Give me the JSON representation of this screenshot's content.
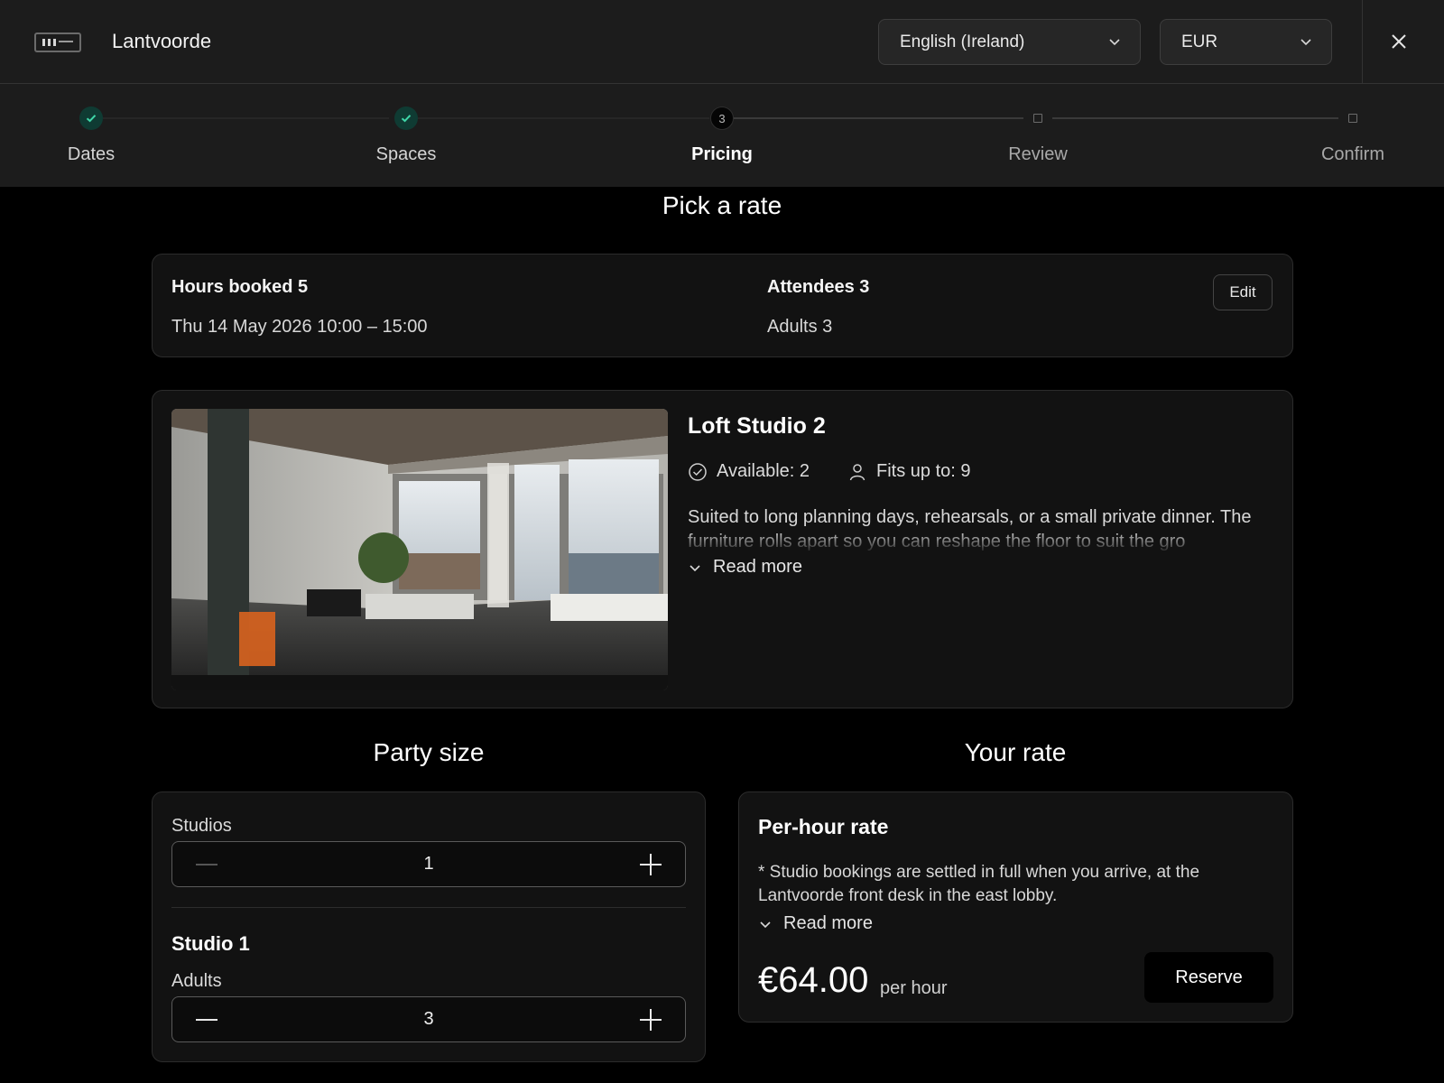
{
  "header": {
    "brand": "Lantvoorde",
    "language": "English (Ireland)",
    "currency": "EUR"
  },
  "steps": [
    {
      "label": "Dates",
      "state": "done"
    },
    {
      "label": "Spaces",
      "state": "done"
    },
    {
      "label": "Pricing",
      "state": "current",
      "number": "3"
    },
    {
      "label": "Review",
      "state": "todo"
    },
    {
      "label": "Confirm",
      "state": "todo"
    }
  ],
  "page_title": "Pick a rate",
  "summary": {
    "hours_heading": "Hours booked 5",
    "date_time": "Thu 14 May 2026  10:00 – 15:00",
    "attendees_heading": "Attendees 3",
    "adults": "Adults 3",
    "edit_label": "Edit"
  },
  "room": {
    "name": "Loft Studio 2",
    "available": "Available: 2",
    "fits": "Fits up to: 9",
    "description": "Suited to long planning days, rehearsals, or a small private dinner. The furniture rolls apart so you can reshape the floor to suit the gro",
    "read_more": "Read more"
  },
  "party": {
    "heading": "Party size",
    "studios_label": "Studios",
    "studios_value": "1",
    "studio_heading": "Studio 1",
    "adults_label": "Adults",
    "adults_value": "3"
  },
  "rate": {
    "heading": "Your rate",
    "title": "Per-hour rate",
    "note": "* Studio bookings are settled in full when you arrive, at the Lantvoorde front desk in the east lobby.",
    "read_more": "Read more",
    "price": "€64.00",
    "unit": "per hour",
    "reserve_label": "Reserve"
  },
  "colors": {
    "header_bg": "#1c1c1c",
    "page_bg": "#000000",
    "card_bg": "#121212",
    "done_dot": "#0f3b33",
    "check": "#3fd6a8"
  }
}
